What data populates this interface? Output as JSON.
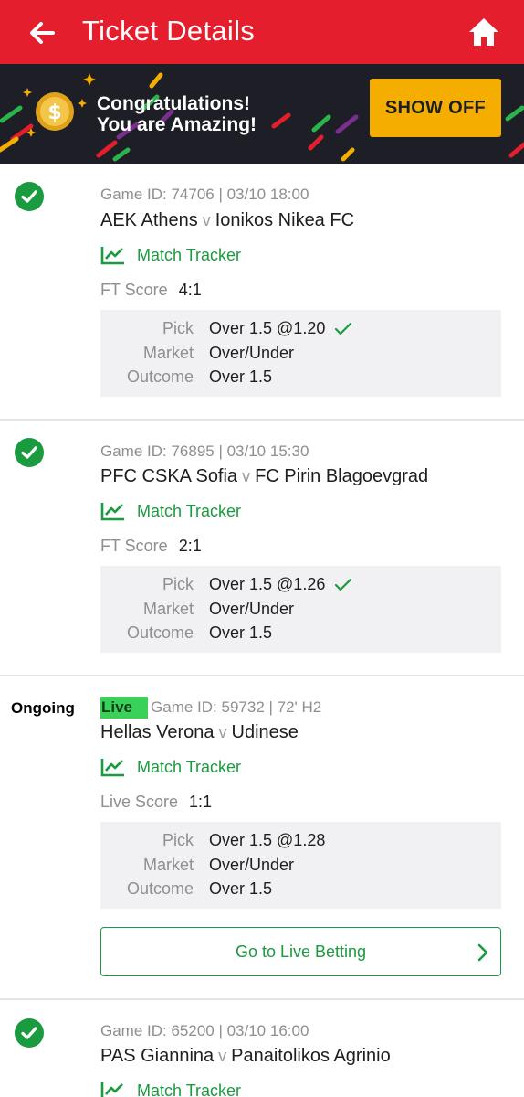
{
  "header": {
    "title": "Ticket Details",
    "back_icon": "arrow-left-icon",
    "home_icon": "home-icon",
    "color": "#e41e2d"
  },
  "banner": {
    "line1": "Congratulations!",
    "line2": "You are Amazing!",
    "button": "SHOW OFF",
    "button_color": "#f5ae00"
  },
  "bets": [
    {
      "status": "won",
      "game_meta": "Game ID: 74706 | 03/10 18:00",
      "home": "AEK Athens",
      "vs": "v",
      "away": "Ionikos Nikea FC",
      "tracker": "Match Tracker",
      "score_label": "FT Score",
      "score": "4:1",
      "pick_label": "Pick",
      "pick": "Over 1.5 @1.20",
      "market_label": "Market",
      "market": "Over/Under",
      "outcome_label": "Outcome",
      "outcome": "Over 1.5"
    },
    {
      "status": "won",
      "game_meta": "Game ID: 76895 | 03/10 15:30",
      "home": "PFC CSKA Sofia",
      "vs": "v",
      "away": "FC Pirin Blagoevgrad",
      "tracker": "Match Tracker",
      "score_label": "FT Score",
      "score": "2:1",
      "pick_label": "Pick",
      "pick": "Over 1.5 @1.26",
      "market_label": "Market",
      "market": "Over/Under",
      "outcome_label": "Outcome",
      "outcome": "Over 1.5"
    },
    {
      "status": "ongoing",
      "status_label": "Ongoing",
      "live_badge": "Live",
      "game_meta": "Game ID: 59732 | 72' H2",
      "home": "Hellas Verona",
      "vs": "v",
      "away": "Udinese",
      "tracker": "Match Tracker",
      "score_label": "Live Score",
      "score": "1:1",
      "pick_label": "Pick",
      "pick": "Over 1.5 @1.28",
      "market_label": "Market",
      "market": "Over/Under",
      "outcome_label": "Outcome",
      "outcome": "Over 1.5",
      "live_betting_button": "Go to Live Betting"
    },
    {
      "status": "won",
      "game_meta": "Game ID: 65200 | 03/10 16:00",
      "home": "PAS Giannina",
      "vs": "v",
      "away": "Panaitolikos Agrinio",
      "tracker": "Match Tracker"
    }
  ],
  "colors": {
    "accent_green": "#1a9b3f",
    "live_green": "#3ad15b",
    "muted_text": "#8e8e93"
  }
}
